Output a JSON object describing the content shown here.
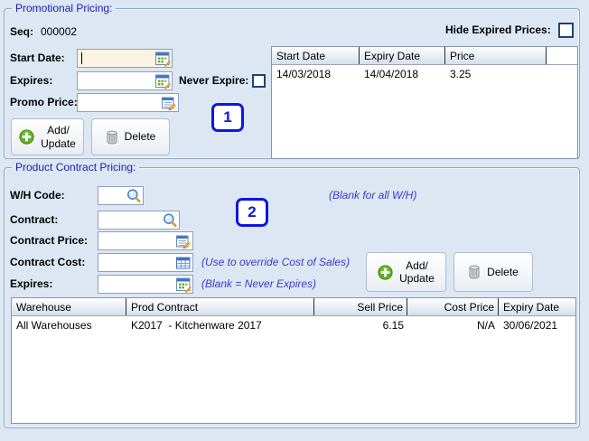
{
  "colors": {
    "background": "#dce7f3",
    "group_title_blue": "#1b1bb0",
    "hint_blue": "#3b3bc8",
    "badge_blue": "#0d17e0",
    "focus_field_bg": "#fcf4e3",
    "add_green": "#5fb321",
    "header_gradient_bottom": "#d5dfeb"
  },
  "icons": {
    "date_picker": "calendar-icon",
    "price_edit": "edit-pencil-icon",
    "lookup": "search-icon",
    "cost": "calculator-icon",
    "add": "plus-circle-icon",
    "delete": "trash-icon"
  },
  "promo": {
    "title": "Promotional Pricing:",
    "seq_label": "Seq:",
    "seq_value": "000002",
    "start_date_label": "Start Date:",
    "expires_label": "Expires:",
    "never_expire_label": "Never Expire:",
    "promo_price_label": "Promo Price:",
    "add_update_line1": "Add/",
    "add_update_line2": "Update",
    "delete_label": "Delete",
    "hide_expired_label": "Hide Expired Prices:",
    "badge": "1",
    "fields": {
      "start_date_value": "",
      "expires_value": "",
      "promo_price_value": ""
    },
    "table": {
      "columns": [
        "Start Date",
        "Expiry Date",
        "Price"
      ],
      "rows": [
        [
          "14/03/2018",
          "14/04/2018",
          "3.25"
        ]
      ]
    }
  },
  "contract": {
    "title": "Product Contract Pricing:",
    "wh_code_label": "W/H Code:",
    "contract_label": "Contract:",
    "contract_price_label": "Contract Price:",
    "contract_cost_label": "Contract Cost:",
    "expires_label": "Expires:",
    "hint_wh": "(Blank for all W/H)",
    "hint_cost": "(Use to override Cost of Sales)",
    "hint_expires": "(Blank = Never Expires)",
    "add_update_line1": "Add/",
    "add_update_line2": "Update",
    "delete_label": "Delete",
    "badge": "2",
    "fields": {
      "wh_code_value": "",
      "contract_value": "",
      "contract_price_value": "",
      "contract_cost_value": "",
      "expires_value": ""
    },
    "table": {
      "columns": [
        "Warehouse",
        "Prod Contract",
        "Sell Price",
        "Cost Price",
        "Expiry Date"
      ],
      "rows": [
        [
          "All Warehouses",
          "K2017  - Kitchenware 2017",
          "6.15",
          "N/A",
          "30/06/2021"
        ]
      ]
    }
  }
}
